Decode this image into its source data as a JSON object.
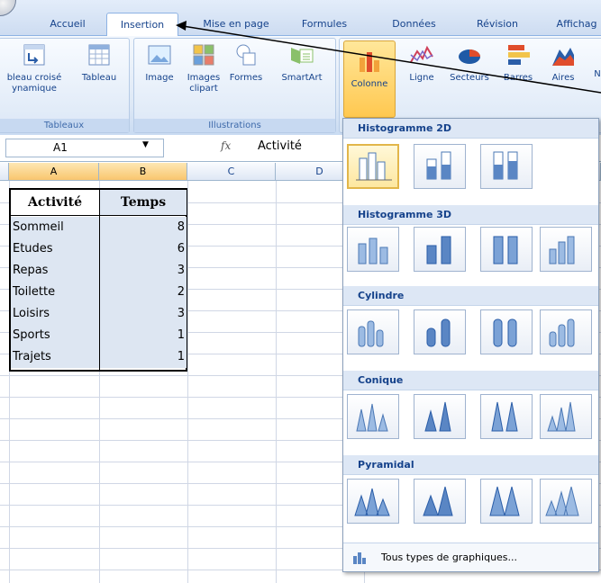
{
  "tabs": [
    "Accueil",
    "Insertion",
    "Mise en page",
    "Formules",
    "Données",
    "Révision",
    "Affichag"
  ],
  "ribbon": {
    "tableaux": {
      "title": "Tableaux",
      "pivot_l1": "bleau croisé",
      "pivot_l2": "ynamique",
      "table": "Tableau"
    },
    "illustrations": {
      "title": "Illustrations",
      "image": "Image",
      "clipart_l1": "Images",
      "clipart_l2": "clipart",
      "shapes": "Formes",
      "smartart": "SmartArt"
    },
    "charts": {
      "colonne": "Colonne",
      "ligne": "Ligne",
      "secteurs": "Secteurs",
      "barres": "Barres",
      "aires": "Aires",
      "next": "N"
    }
  },
  "formula": {
    "namebox": "A1",
    "fx": "fx",
    "value": "Activité"
  },
  "columns": [
    "A",
    "B",
    "C",
    "D"
  ],
  "table": {
    "header": [
      "Activité",
      "Temps"
    ],
    "rows": [
      [
        "Sommeil",
        "8"
      ],
      [
        "Etudes",
        "6"
      ],
      [
        "Repas",
        "3"
      ],
      [
        "Toilette",
        "2"
      ],
      [
        "Loisirs",
        "3"
      ],
      [
        "Sports",
        "1"
      ],
      [
        "Trajets",
        "1"
      ]
    ]
  },
  "dropdown": {
    "sections": [
      "Histogramme 2D",
      "Histogramme 3D",
      "Cylindre",
      "Conique",
      "Pyramidal"
    ],
    "footer": "Tous types de graphiques..."
  },
  "colors": {
    "accent": "#ffc850",
    "ribbon": "#dde8f6",
    "header": "#15428b"
  }
}
